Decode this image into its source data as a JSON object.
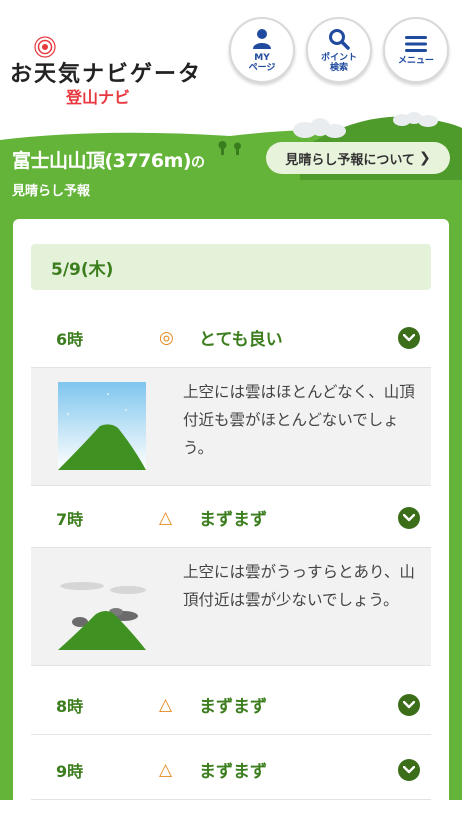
{
  "header": {
    "logo_text": "お天気ナビゲータ",
    "logo_sub": "登山ナビ",
    "buttons": [
      {
        "label_line1": "MY",
        "label_line2": "ページ",
        "icon": "person-icon"
      },
      {
        "label_line1": "ポイント",
        "label_line2": "検索",
        "icon": "search-icon"
      },
      {
        "label_line1": "メニュー",
        "label_line2": "",
        "icon": "hamburger-icon"
      }
    ]
  },
  "page": {
    "title": "富士山山頂(3776m)",
    "title_suffix": "の",
    "subtitle": "見晴らし予報",
    "about_button": "見晴らし予報について"
  },
  "forecast": {
    "date": "5/9(木)",
    "rows": [
      {
        "hour": "6時",
        "mark": "◎",
        "rating": "とても良い",
        "expanded": true,
        "description": "上空には雲はほとんどなく、山頂付近も雲がほとんどないでしょう。",
        "sky": "clear"
      },
      {
        "hour": "7時",
        "mark": "△",
        "rating": "まずまず",
        "expanded": true,
        "description": "上空には雲がうっすらとあり、山頂付近は雲が少ないでしょう。",
        "sky": "thin-cloud"
      },
      {
        "hour": "8時",
        "mark": "△",
        "rating": "まずまず",
        "expanded": false
      },
      {
        "hour": "9時",
        "mark": "△",
        "rating": "まずまず",
        "expanded": false
      }
    ]
  },
  "colors": {
    "green_band": "#64b43a",
    "dark_green_text": "#3c7e1e",
    "orange_mark": "#e48a1e",
    "nav_blue": "#1f4a9e",
    "logo_red": "#e8393f"
  }
}
